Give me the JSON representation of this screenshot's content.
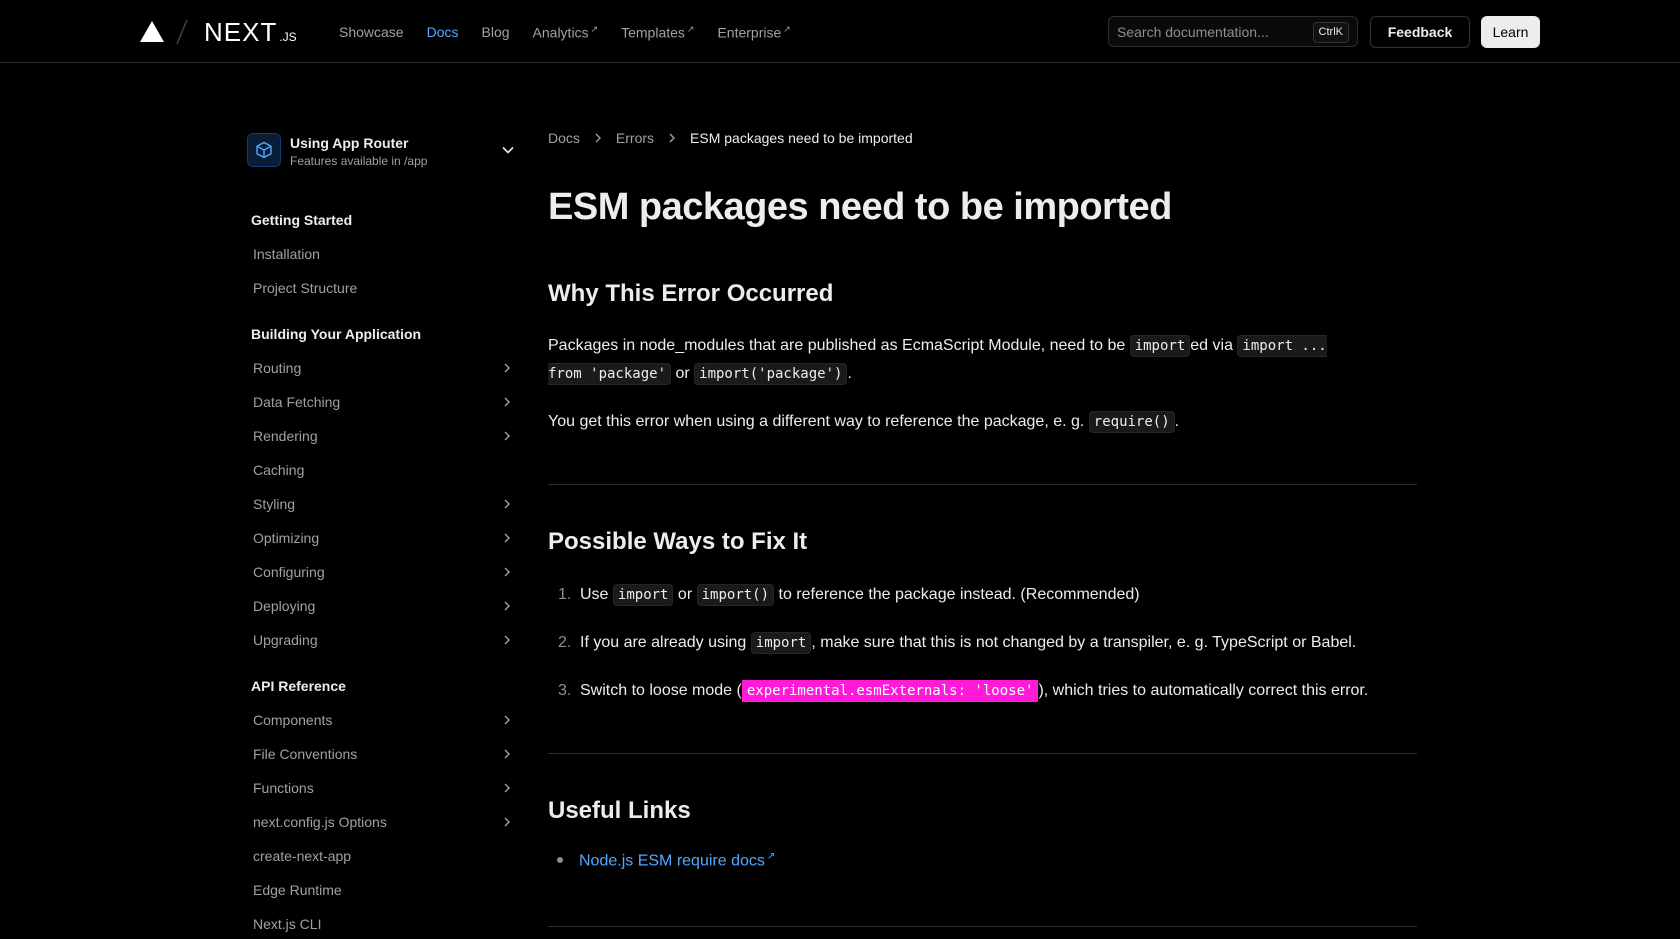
{
  "header": {
    "logo_text": "NEXT",
    "logo_suffix": ".JS",
    "nav": [
      {
        "label": "Showcase",
        "active": false,
        "external": false
      },
      {
        "label": "Docs",
        "active": true,
        "external": false
      },
      {
        "label": "Blog",
        "active": false,
        "external": false
      },
      {
        "label": "Analytics",
        "active": false,
        "external": true
      },
      {
        "label": "Templates",
        "active": false,
        "external": true
      },
      {
        "label": "Enterprise",
        "active": false,
        "external": true
      }
    ],
    "external_glyph": "↗",
    "search_placeholder": "Search documentation...",
    "search_shortcut": "CtrlK",
    "feedback_label": "Feedback",
    "learn_label": "Learn"
  },
  "sidebar": {
    "router_title": "Using App Router",
    "router_subtitle": "Features available in /app",
    "sections": [
      {
        "title": "Getting Started",
        "items": [
          {
            "label": "Installation",
            "expandable": false
          },
          {
            "label": "Project Structure",
            "expandable": false
          }
        ]
      },
      {
        "title": "Building Your Application",
        "items": [
          {
            "label": "Routing",
            "expandable": true
          },
          {
            "label": "Data Fetching",
            "expandable": true
          },
          {
            "label": "Rendering",
            "expandable": true
          },
          {
            "label": "Caching",
            "expandable": false
          },
          {
            "label": "Styling",
            "expandable": true
          },
          {
            "label": "Optimizing",
            "expandable": true
          },
          {
            "label": "Configuring",
            "expandable": true
          },
          {
            "label": "Deploying",
            "expandable": true
          },
          {
            "label": "Upgrading",
            "expandable": true
          }
        ]
      },
      {
        "title": "API Reference",
        "items": [
          {
            "label": "Components",
            "expandable": true
          },
          {
            "label": "File Conventions",
            "expandable": true
          },
          {
            "label": "Functions",
            "expandable": true
          },
          {
            "label": "next.config.js Options",
            "expandable": true
          },
          {
            "label": "create-next-app",
            "expandable": false
          },
          {
            "label": "Edge Runtime",
            "expandable": false
          },
          {
            "label": "Next.js CLI",
            "expandable": false
          }
        ]
      }
    ]
  },
  "breadcrumb": [
    "Docs",
    "Errors",
    "ESM packages need to be imported"
  ],
  "article": {
    "title": "ESM packages need to be imported",
    "why_heading": "Why This Error Occurred",
    "p1": {
      "t1": "Packages in node_modules that are published as EcmaScript Module, need to be ",
      "c1": "import",
      "t2": "ed via ",
      "c2": "import ... from 'package'",
      "t3": " or ",
      "c3": "import('package')",
      "t4": "."
    },
    "p2": {
      "t1": "You get this error when using a different way to reference the package, e. g. ",
      "c1": "require()",
      "t2": "."
    },
    "fix_heading": "Possible Ways to Fix It",
    "fix_items": [
      {
        "num": "1.",
        "t1": "Use ",
        "c1": "import",
        "t2": " or ",
        "c2": "import()",
        "t3": " to reference the package instead. (Recommended)"
      },
      {
        "num": "2.",
        "t1": "If you are already using ",
        "c1": "import",
        "t2": ", make sure that this is not changed by a transpiler, e. g. TypeScript or Babel."
      },
      {
        "num": "3.",
        "t1": "Switch to loose mode (",
        "c1": "experimental.esmExternals: 'loose'",
        "t2": "), which tries to automatically correct this error."
      }
    ],
    "links_heading": "Useful Links",
    "links": [
      {
        "label": "Node.js ESM require docs"
      }
    ]
  },
  "colors": {
    "background": "#000000",
    "link": "#52a8ff",
    "highlight": "#ff1ad9"
  }
}
